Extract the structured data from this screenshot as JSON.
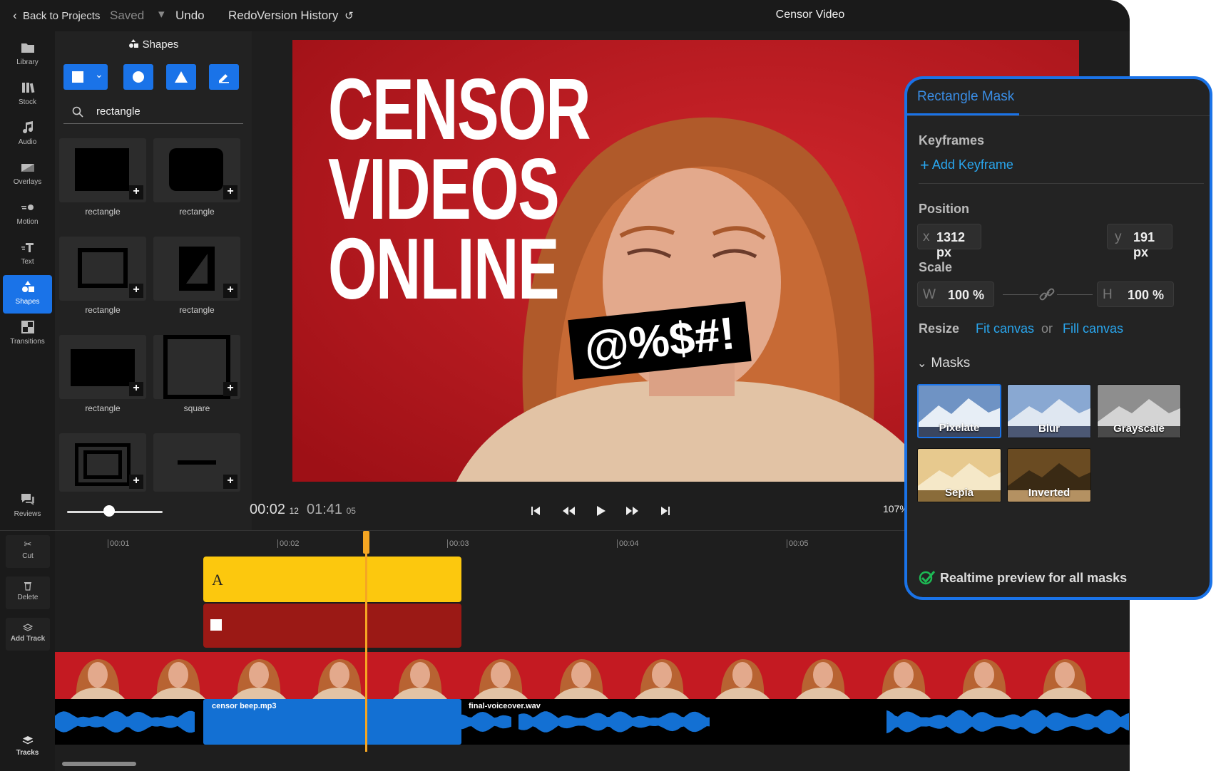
{
  "topbar": {
    "back_label": "Back to Projects",
    "saved_label": "Saved",
    "undo_label": "Undo",
    "redo_label": "Redo",
    "version_history_label": "Version History",
    "title": "Censor Video"
  },
  "sidebar": {
    "items": [
      {
        "label": "Library"
      },
      {
        "label": "Stock"
      },
      {
        "label": "Audio"
      },
      {
        "label": "Overlays"
      },
      {
        "label": "Motion"
      },
      {
        "label": "Text"
      },
      {
        "label": "Shapes"
      },
      {
        "label": "Transitions"
      }
    ],
    "reviews_label": "Reviews"
  },
  "shapes_panel": {
    "title": "Shapes",
    "search_value": "rectangle",
    "items": [
      {
        "label": "rectangle"
      },
      {
        "label": "rectangle"
      },
      {
        "label": "rectangle"
      },
      {
        "label": "rectangle"
      },
      {
        "label": "rectangle"
      },
      {
        "label": "square"
      }
    ],
    "zoom_fraction": 0.44
  },
  "preview": {
    "headline": [
      "CENSOR",
      "VIDEOS",
      "ONLINE"
    ],
    "censor_text": "@%$#!",
    "time_current": "00:02",
    "time_current_frames": "12",
    "time_total": "01:41",
    "time_total_frames": "05",
    "zoom_label": "107%"
  },
  "timeline": {
    "ticks": [
      "00:01",
      "00:02",
      "00:03",
      "00:04",
      "00:05"
    ],
    "text_clip_label": "A",
    "audio_clips": [
      {
        "label": "censor beep.mp3"
      },
      {
        "label": "final-voiceover.wav"
      }
    ],
    "side_buttons": [
      {
        "label": "Cut"
      },
      {
        "label": "Delete"
      },
      {
        "label": "Add Track"
      }
    ],
    "tracks_label": "Tracks"
  },
  "mask_panel": {
    "tab_label": "Rectangle Mask",
    "keyframes_label": "Keyframes",
    "add_keyframe_label": "Add Keyframe",
    "position_label": "Position",
    "x_key": "x",
    "x_value": "1312 px",
    "y_key": "y",
    "y_value": "191 px",
    "scale_label": "Scale",
    "w_key": "W",
    "w_value": "100 %",
    "h_key": "H",
    "h_value": "100 %",
    "resize_label": "Resize",
    "fit_canvas_label": "Fit canvas",
    "or_label": "or",
    "fill_canvas_label": "Fill canvas",
    "masks_label": "Masks",
    "masks": [
      {
        "label": "Pixelate",
        "selected": true
      },
      {
        "label": "Blur"
      },
      {
        "label": "Grayscale"
      },
      {
        "label": "Sepia"
      },
      {
        "label": "Inverted"
      }
    ],
    "realtime_label": "Realtime preview for all masks"
  },
  "colors": {
    "accent": "#1a73e8",
    "text_clip": "#fcc80e",
    "shape_clip": "#9b1915",
    "audio_clip": "#1370d3",
    "playhead": "#f5a623"
  }
}
